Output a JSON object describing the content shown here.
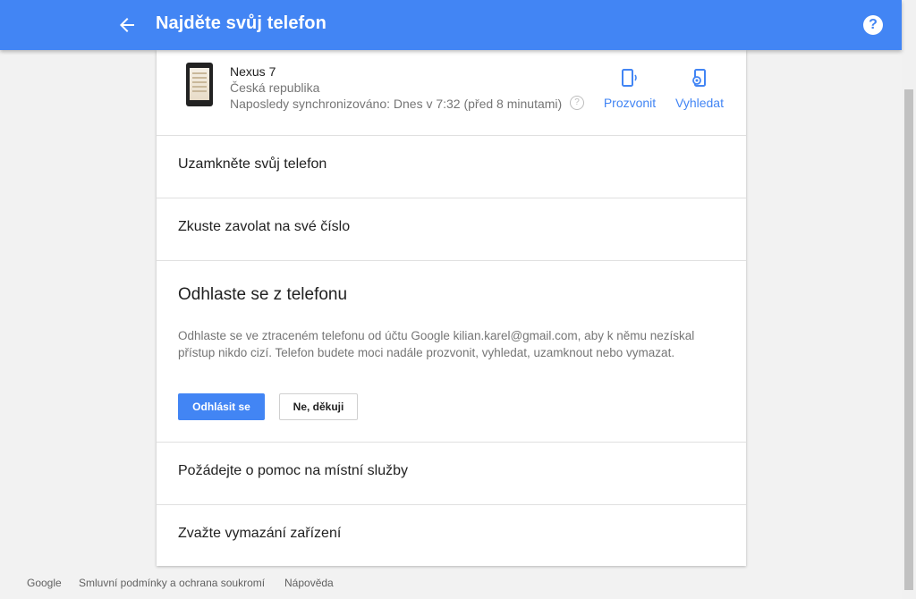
{
  "header": {
    "title": "Najděte svůj telefon",
    "color": "#4285f4",
    "help_label": "?"
  },
  "device": {
    "name": "Nexus 7",
    "country": "Česká republika",
    "last_sync": "Naposledy synchronizováno: Dnes v 7:32 (před 8 minutami)",
    "info_glyph": "?",
    "actions": {
      "ring_label": "Prozvonit",
      "locate_label": "Vyhledat"
    }
  },
  "options": {
    "lock": "Uzamkněte svůj telefon",
    "call": "Zkuste zavolat na své číslo",
    "signout": {
      "title": "Odhlaste se z telefonu",
      "description": "Odhlaste se ve ztraceném telefonu od účtu Google kilian.karel@gmail.com, aby k němu nezískal přístup nikdo cizí. Telefon budete moci nadále prozvonit, vyhledat, uzamknout nebo vymazat.",
      "primary_label": "Odhlásit se",
      "secondary_label": "Ne, děkuji"
    },
    "local_help": "Požádejte o pomoc na místní služby",
    "erase": "Zvažte vymazání zařízení"
  },
  "footer": {
    "google": "Google",
    "terms": "Smluvní podmínky a ochrana soukromí",
    "help": "Nápověda"
  }
}
